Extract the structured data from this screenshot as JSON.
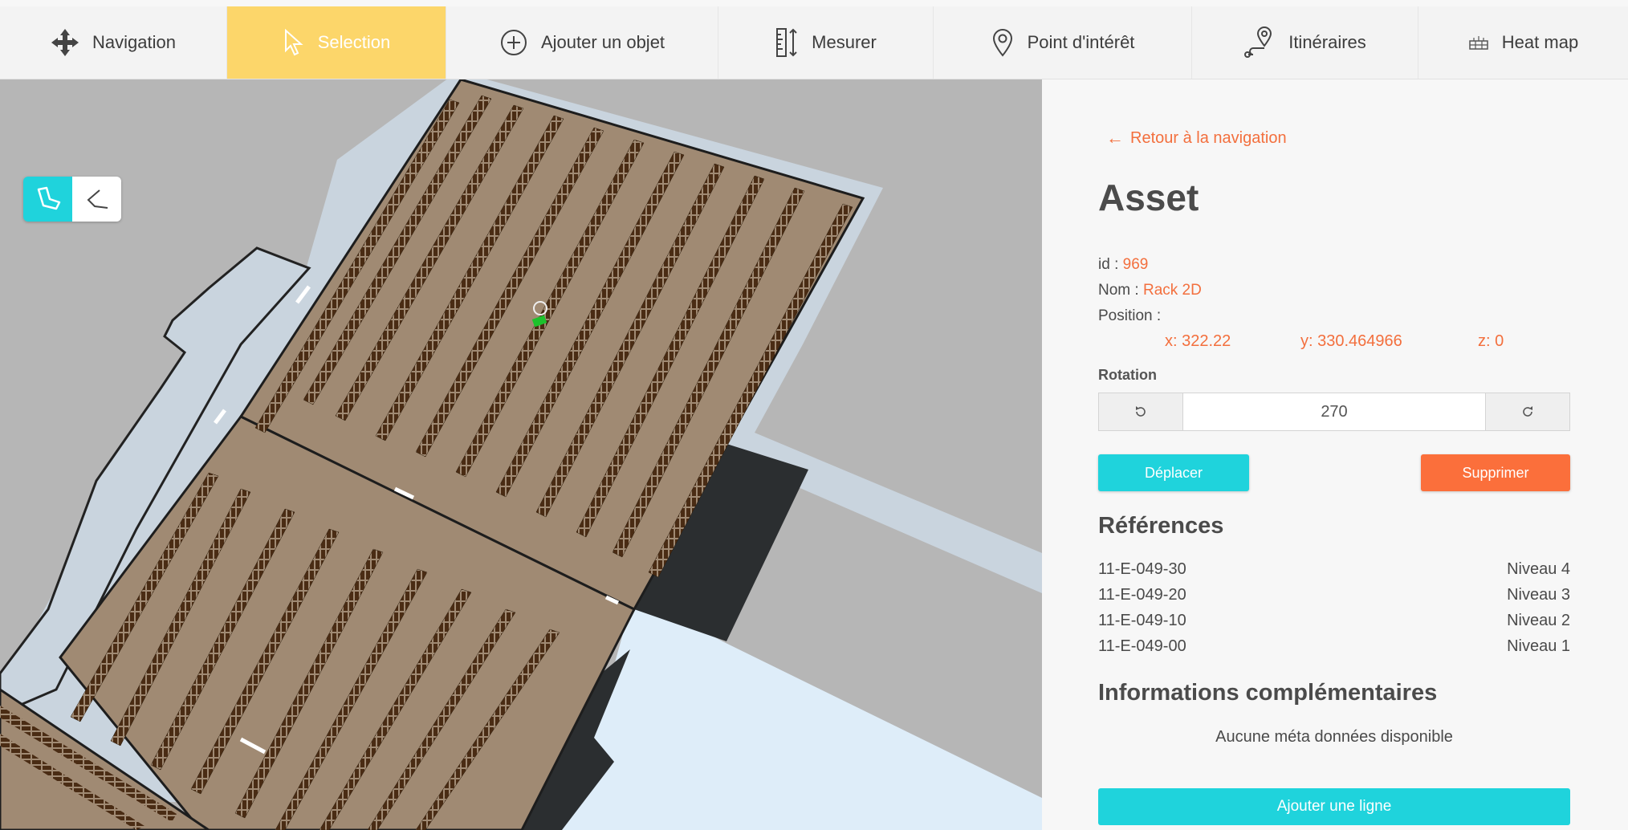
{
  "toolbar": {
    "items": [
      {
        "label": "Navigation",
        "icon": "move-arrows-icon"
      },
      {
        "label": "Selection",
        "icon": "cursor-icon"
      },
      {
        "label": "Ajouter un objet",
        "icon": "plus-circle-icon"
      },
      {
        "label": "Mesurer",
        "icon": "ruler-icon"
      },
      {
        "label": "Point d'intérêt",
        "icon": "map-pin-icon"
      },
      {
        "label": "Itinéraires",
        "icon": "route-icon"
      },
      {
        "label": "Heat map",
        "icon": "heatmap-icon"
      }
    ],
    "active": "Selection",
    "active_color": "#fcd66a"
  },
  "map": {
    "view_toggle": {
      "active": "3d-view",
      "options": [
        "3d-view",
        "2d-view"
      ]
    },
    "colors": {
      "background": "#b6b6b6",
      "floor": "#a08a73",
      "rack": "#4a2c14",
      "corridor": "#c9d4de",
      "light_zone": "#deedf9",
      "dark_zone": "#2b2e30"
    }
  },
  "panel": {
    "back_link": "Retour à la navigation",
    "title": "Asset",
    "id_label": "id :",
    "id_value": "969",
    "name_label": "Nom :",
    "name_value": "Rack 2D",
    "position_label": "Position :",
    "position": {
      "x": "x: 322.22",
      "y": "y: 330.464966",
      "z": "z: 0"
    },
    "rotation_label": "Rotation",
    "rotation_value": "270",
    "move_button": "Déplacer",
    "delete_button": "Supprimer",
    "references_title": "Références",
    "references": [
      {
        "code": "11-E-049-30",
        "level": "Niveau 4"
      },
      {
        "code": "11-E-049-20",
        "level": "Niveau 3"
      },
      {
        "code": "11-E-049-10",
        "level": "Niveau 2"
      },
      {
        "code": "11-E-049-00",
        "level": "Niveau 1"
      }
    ],
    "extra_title": "Informations complémentaires",
    "no_meta": "Aucune méta données disponible",
    "add_line_button": "Ajouter une ligne",
    "accent": "#f36f3d",
    "cyan": "#1fd3dc"
  }
}
